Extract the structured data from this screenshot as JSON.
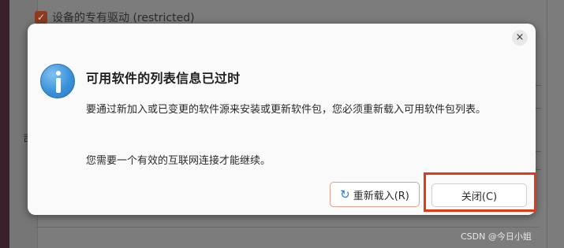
{
  "background": {
    "checkbox_label": "设备的专有驱动 (restricted)",
    "checkbox_mark": "✓",
    "side_glyph": "司"
  },
  "dialog": {
    "title": "可用软件的列表信息已过时",
    "message": "要通过新加入或已变更的软件源来安装或更新软件包，您必须重新载入可用软件包列表。",
    "message2": "您需要一个有效的互联网连接才能继续。",
    "close_icon_glyph": "×",
    "buttons": {
      "reload_icon_glyph": "↻",
      "reload_label": "重新载入(R)",
      "close_label": "关闭(C)"
    }
  },
  "watermark": "CSDN @今日小姐",
  "colors": {
    "highlight": "#e23a18",
    "info_icon": "#3b93da",
    "reload_border": "#e0a08a"
  }
}
